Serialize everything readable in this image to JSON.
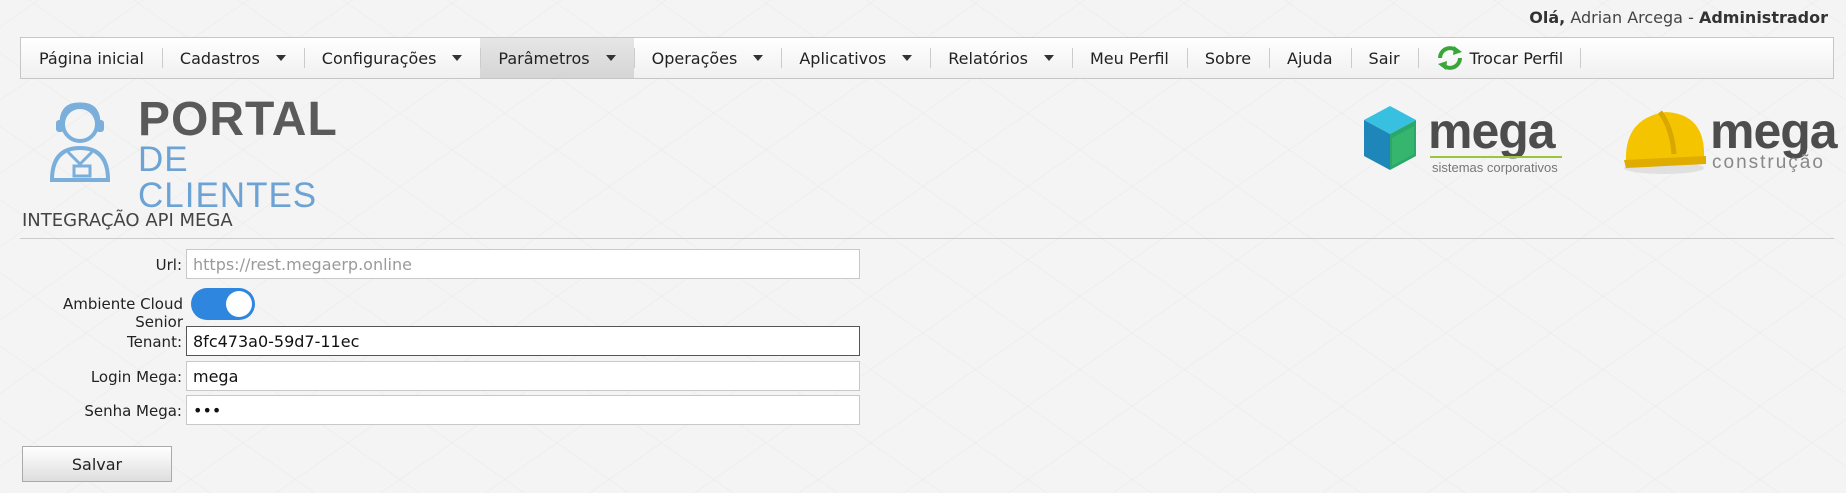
{
  "header": {
    "greeting_prefix": "Olá,",
    "user_name": "Adrian Arcega",
    "separator": "-",
    "role": "Administrador"
  },
  "nav": {
    "items": [
      {
        "label": "Página inicial"
      },
      {
        "label": "Cadastros"
      },
      {
        "label": "Configurações"
      },
      {
        "label": "Parâmetros"
      },
      {
        "label": "Operações"
      },
      {
        "label": "Aplicativos"
      },
      {
        "label": "Relatórios"
      },
      {
        "label": "Meu Perfil"
      },
      {
        "label": "Sobre"
      },
      {
        "label": "Ajuda"
      },
      {
        "label": "Sair"
      },
      {
        "label": "Trocar Perfil"
      }
    ],
    "active_index": 3
  },
  "logos": {
    "portal_title": "PORTAL",
    "portal_subtitle": "DE CLIENTES",
    "mega1_word": "mega",
    "mega1_tagline": "sistemas corporativos",
    "mega2_word": "mega",
    "mega2_tagline": "construção"
  },
  "form": {
    "title": "INTEGRAÇÃO API MEGA",
    "url_label": "Url:",
    "url_placeholder": "https://rest.megaerp.online",
    "url_value": "",
    "cloud_label": "Ambiente Cloud Senior",
    "cloud_enabled": true,
    "tenant_label": "Tenant:",
    "tenant_value": "8fc473a0-59d7-11ec",
    "login_label": "Login Mega:",
    "login_value": "mega",
    "password_label": "Senha Mega:",
    "password_value": "abc",
    "save_label": "Salvar"
  },
  "colors": {
    "toggle_on": "#2f86de",
    "portal_blue": "#6ca3d4",
    "mega_green": "#9bc53d",
    "helmet_yellow": "#f5c400"
  }
}
